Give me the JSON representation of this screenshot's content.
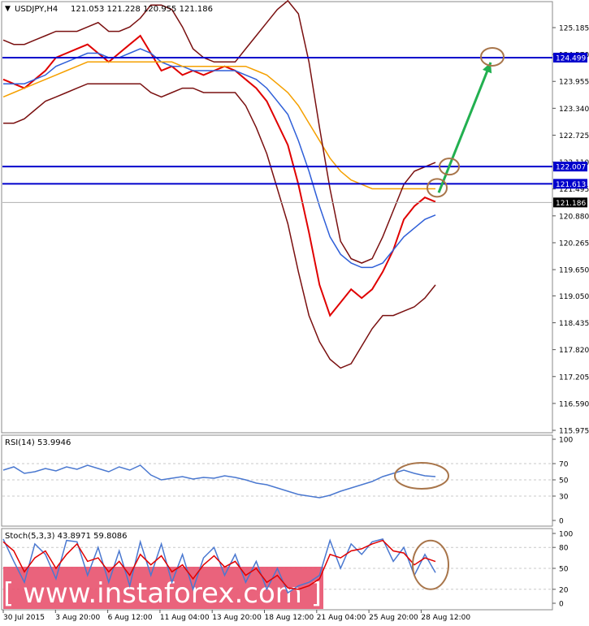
{
  "header": {
    "symbol": "USDJPY,H4",
    "ohlc": "121.053 121.228 120.955 121.186",
    "menu_glyph": "▼"
  },
  "chart_data": [
    {
      "type": "line",
      "panel": "price",
      "y_ticks": [
        "125.185",
        "124.570",
        "123.955",
        "123.340",
        "122.725",
        "122.110",
        "121.495",
        "120.880",
        "120.265",
        "119.650",
        "119.050",
        "118.435",
        "117.820",
        "117.205",
        "116.590",
        "115.975"
      ],
      "ylim": [
        115.975,
        125.185
      ],
      "price_labels": [
        "124.499",
        "122.007",
        "121.613",
        "121.186"
      ],
      "hlines": [
        124.499,
        122.007,
        121.613
      ],
      "last_price": 121.186,
      "series": [
        {
          "name": "",
          "color": "#e00000",
          "values": [
            124.0,
            123.9,
            123.8,
            124.0,
            124.2,
            124.5,
            124.6,
            124.7,
            124.8,
            124.6,
            124.4,
            124.6,
            124.8,
            125.0,
            124.6,
            124.2,
            124.3,
            124.1,
            124.2,
            124.1,
            124.2,
            124.3,
            124.2,
            124.0,
            123.8,
            123.5,
            123.0,
            122.5,
            121.6,
            120.5,
            119.3,
            118.6,
            118.9,
            119.2,
            119.0,
            119.2,
            119.6,
            120.1,
            120.8,
            121.1,
            121.3,
            121.2
          ]
        },
        {
          "name": "",
          "color": "#2f5fd8",
          "values": [
            123.9,
            123.9,
            123.9,
            124.0,
            124.1,
            124.3,
            124.4,
            124.5,
            124.6,
            124.6,
            124.5,
            124.5,
            124.6,
            124.7,
            124.6,
            124.4,
            124.3,
            124.3,
            124.2,
            124.2,
            124.2,
            124.2,
            124.2,
            124.1,
            124.0,
            123.8,
            123.5,
            123.2,
            122.6,
            121.9,
            121.1,
            120.4,
            120.0,
            119.8,
            119.7,
            119.7,
            119.8,
            120.1,
            120.4,
            120.6,
            120.8,
            120.9
          ]
        },
        {
          "name": "",
          "color": "#f5a000",
          "values": [
            123.6,
            123.7,
            123.8,
            123.9,
            124.0,
            124.1,
            124.2,
            124.3,
            124.4,
            124.4,
            124.4,
            124.4,
            124.4,
            124.4,
            124.4,
            124.4,
            124.4,
            124.3,
            124.3,
            124.3,
            124.3,
            124.3,
            124.3,
            124.3,
            124.2,
            124.1,
            123.9,
            123.7,
            123.4,
            123.0,
            122.6,
            122.2,
            121.9,
            121.7,
            121.6,
            121.5,
            121.5,
            121.5,
            121.5,
            121.5,
            121.5,
            121.5
          ]
        },
        {
          "name": "",
          "color": "#7a1010",
          "values": [
            124.9,
            124.8,
            124.8,
            124.9,
            125.0,
            125.1,
            125.1,
            125.1,
            125.2,
            125.3,
            125.1,
            125.1,
            125.2,
            125.4,
            125.7,
            125.7,
            125.6,
            125.2,
            124.7,
            124.5,
            124.4,
            124.4,
            124.4,
            124.7,
            125.0,
            125.3,
            125.6,
            125.8,
            125.5,
            124.4,
            122.9,
            121.5,
            120.3,
            119.9,
            119.8,
            119.9,
            120.4,
            121.0,
            121.6,
            121.9,
            122.0,
            122.1
          ]
        },
        {
          "name": "",
          "color": "#7a1010",
          "values": [
            123.0,
            123.0,
            123.1,
            123.3,
            123.5,
            123.6,
            123.7,
            123.8,
            123.9,
            123.9,
            123.9,
            123.9,
            123.9,
            123.9,
            123.7,
            123.6,
            123.7,
            123.8,
            123.8,
            123.7,
            123.7,
            123.7,
            123.7,
            123.4,
            122.9,
            122.3,
            121.5,
            120.7,
            119.6,
            118.6,
            118.0,
            117.6,
            117.4,
            117.5,
            117.9,
            118.3,
            118.6,
            118.6,
            118.7,
            118.8,
            119.0,
            119.3
          ]
        }
      ]
    },
    {
      "type": "line",
      "panel": "RSI",
      "title": "RSI(14) 53.9946",
      "y_ticks": [
        "100",
        "70",
        "50",
        "30",
        "0"
      ],
      "ylim": [
        0,
        100
      ],
      "series": [
        {
          "name": "",
          "color": "#4a78d0",
          "values": [
            62,
            66,
            58,
            60,
            64,
            61,
            66,
            63,
            68,
            64,
            60,
            66,
            62,
            68,
            56,
            50,
            52,
            54,
            51,
            53,
            52,
            55,
            53,
            50,
            46,
            44,
            40,
            36,
            32,
            30,
            28,
            31,
            36,
            40,
            44,
            48,
            54,
            58,
            62,
            58,
            55,
            54
          ]
        }
      ]
    },
    {
      "type": "line",
      "panel": "Stochastic",
      "title": "Stoch(5,3,3) 43.8971 59.8086",
      "y_ticks": [
        "100",
        "80",
        "50",
        "20",
        "0"
      ],
      "ylim": [
        0,
        100
      ],
      "series": [
        {
          "name": "",
          "color": "#4a78d0",
          "values": [
            92,
            60,
            30,
            85,
            70,
            35,
            90,
            88,
            40,
            80,
            30,
            75,
            25,
            88,
            40,
            85,
            30,
            70,
            20,
            65,
            80,
            40,
            70,
            30,
            60,
            20,
            50,
            15,
            25,
            30,
            40,
            90,
            50,
            85,
            70,
            88,
            92,
            60,
            80,
            40,
            70,
            43.9
          ]
        },
        {
          "name": "",
          "color": "#e00000",
          "values": [
            88,
            75,
            45,
            65,
            75,
            50,
            70,
            85,
            60,
            65,
            45,
            60,
            40,
            70,
            55,
            68,
            45,
            55,
            35,
            55,
            68,
            52,
            60,
            40,
            50,
            30,
            40,
            22,
            20,
            25,
            35,
            70,
            65,
            75,
            78,
            85,
            90,
            75,
            72,
            55,
            65,
            59.8
          ]
        }
      ]
    }
  ],
  "x_axis": {
    "labels": [
      "30 Jul 2015",
      "3 Aug 20:00",
      "6 Aug 12:00",
      "11 Aug 04:00",
      "13 Aug 20:00",
      "18 Aug 12:00",
      "21 Aug 04:00",
      "25 Aug 20:00",
      "28 Aug 12:00"
    ]
  },
  "watermark": {
    "text": "[ www.instaforex.com ]"
  },
  "colors": {
    "hline": "#0000cc",
    "label_bg": "#0000cc",
    "last_price_bg": "#000000",
    "arrow": "#22b050",
    "ellipse": "#a8754a",
    "watermark_bg": "#e8526e"
  }
}
